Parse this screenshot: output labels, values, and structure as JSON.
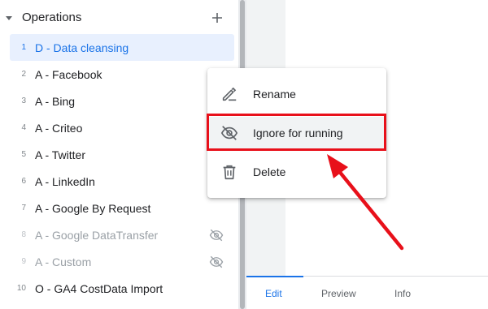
{
  "sidebar": {
    "title": "Operations",
    "items": [
      {
        "num": "1",
        "label": "D - Data cleansing",
        "selected": true,
        "disabled": false
      },
      {
        "num": "2",
        "label": "A - Facebook",
        "selected": false,
        "disabled": false
      },
      {
        "num": "3",
        "label": "A - Bing",
        "selected": false,
        "disabled": false
      },
      {
        "num": "4",
        "label": "A - Criteo",
        "selected": false,
        "disabled": false
      },
      {
        "num": "5",
        "label": "A - Twitter",
        "selected": false,
        "disabled": false
      },
      {
        "num": "6",
        "label": "A - LinkedIn",
        "selected": false,
        "disabled": false
      },
      {
        "num": "7",
        "label": "A - Google By Request",
        "selected": false,
        "disabled": false
      },
      {
        "num": "8",
        "label": "A - Google DataTransfer",
        "selected": false,
        "disabled": true
      },
      {
        "num": "9",
        "label": "A - Custom",
        "selected": false,
        "disabled": true
      },
      {
        "num": "10",
        "label": "O - GA4 CostData Import",
        "selected": false,
        "disabled": false
      }
    ]
  },
  "context_menu": {
    "items": [
      {
        "label": "Rename",
        "icon": "pencil-icon"
      },
      {
        "label": "Ignore for running",
        "icon": "eye-off-icon"
      },
      {
        "label": "Delete",
        "icon": "trash-icon"
      }
    ]
  },
  "tabs": {
    "edit": "Edit",
    "preview": "Preview",
    "info": "Info"
  },
  "colors": {
    "accent": "#1a73e8",
    "annotation": "#e8101a",
    "selected_bg": "#e8f0fe"
  }
}
